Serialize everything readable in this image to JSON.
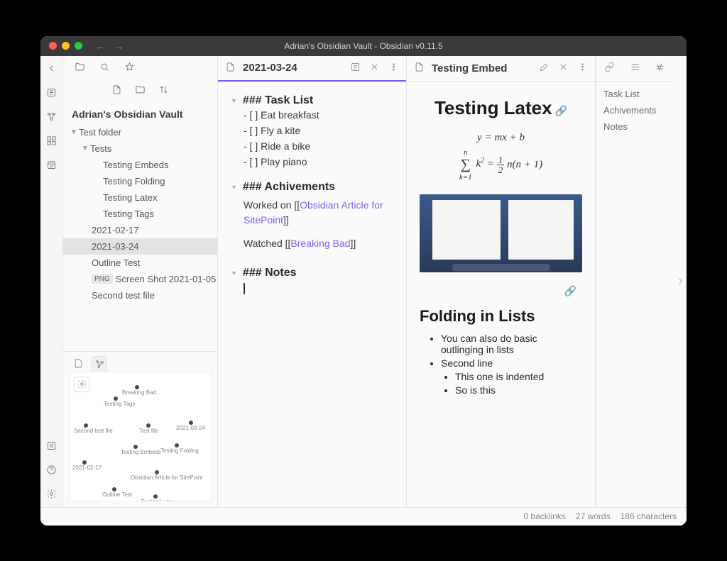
{
  "titlebar": {
    "title": "Adrian's Obsidian Vault - Obsidian v0.11.5"
  },
  "vault": {
    "name": "Adrian's Obsidian Vault"
  },
  "tree": {
    "folder1": "Test folder",
    "folder2": "Tests",
    "files": {
      "f1": "Testing Embeds",
      "f2": "Testing Folding",
      "f3": "Testing Latex",
      "f4": "Testing Tags",
      "f5": "2021-02-17",
      "f6": "2021-03-24",
      "f7": "Outline Test",
      "f8_badge": "PNG",
      "f8": "Screen Shot 2021-01-05",
      "f9": "Second test file"
    }
  },
  "graph": {
    "n1": "Breaking Bad",
    "n2": "Testing Tags",
    "n3": "Second test file",
    "n4": "Test file",
    "n5": "2021-03-24",
    "n6": "Testing Embeds",
    "n7": "Testing Folding",
    "n8": "2021-02-17",
    "n9": "Obsidian Article for SitePoint",
    "n10": "Outline Test",
    "n11": "Testing Latex"
  },
  "pane1": {
    "title": "2021-03-24",
    "h_tasks": "### Task List",
    "t1": "- [ ] Eat breakfast",
    "t2": "- [ ] Fly a kite",
    "t3": "- [ ] Ride a bike",
    "t4": "- [ ] Play piano",
    "h_ach": "### Achivements",
    "ach_pre": "Worked on [[",
    "ach_link": "Obsidian Article for SitePoint",
    "ach_post": "]]",
    "wat_pre": "Watched [[",
    "wat_link": "Breaking Bad",
    "wat_post": "]]",
    "h_notes": "### Notes"
  },
  "pane2": {
    "title": "Testing Embed",
    "h1": "Testing Latex",
    "eq1_pre": "y = mx + b",
    "h2": "Folding in Lists",
    "li1": "You can also do basic outlinging in lists",
    "li2": "Second line",
    "li2a": "This one is indented",
    "li2b": "So is this"
  },
  "outline": {
    "o1": "Task List",
    "o2": "Achivements",
    "o3": "Notes"
  },
  "status": {
    "backlinks": "0 backlinks",
    "words": "27 words",
    "chars": "186 characters"
  }
}
